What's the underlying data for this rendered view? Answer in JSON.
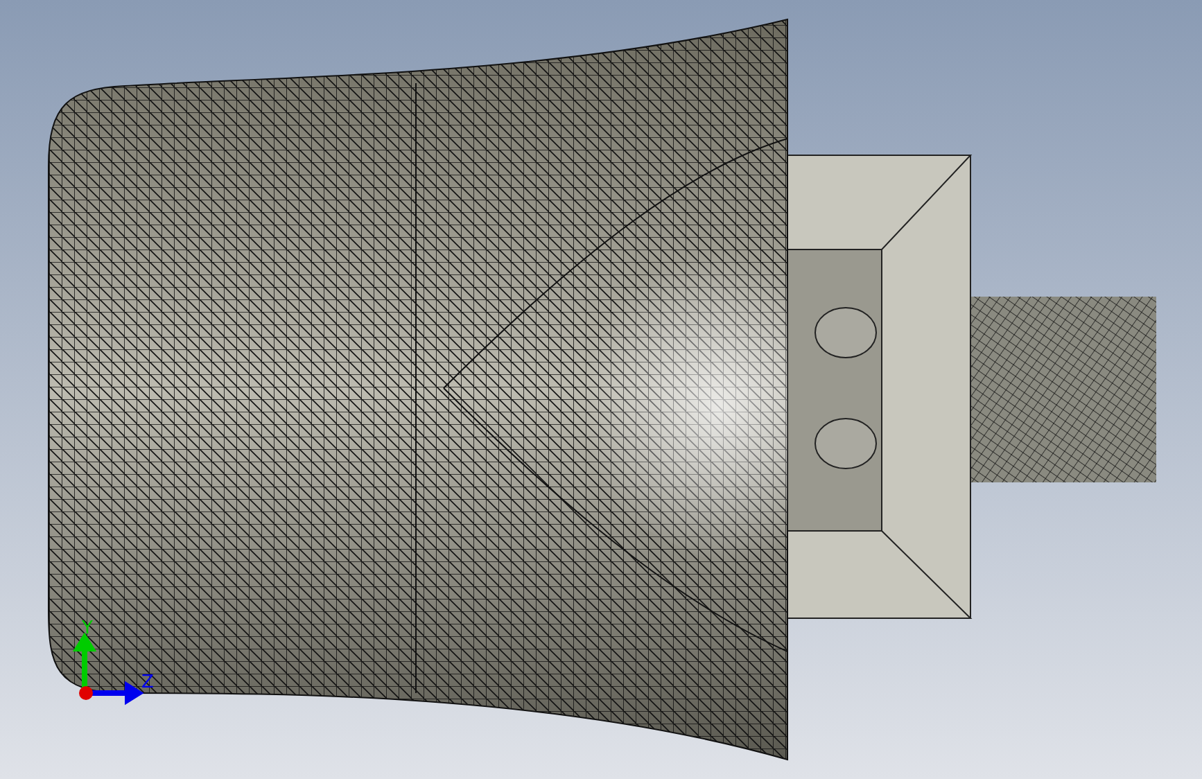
{
  "viewport": {
    "axes": [
      {
        "kind": "y",
        "label": "Y",
        "color": "#00cc00"
      },
      {
        "kind": "z",
        "label": "Z",
        "color": "#0000ee"
      }
    ]
  }
}
